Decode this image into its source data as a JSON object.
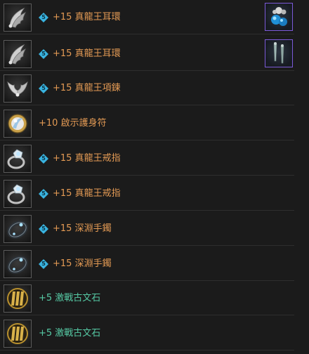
{
  "colors": {
    "orange_text": "#e39a54",
    "green_text": "#56c9a4",
    "badge_blue": "#39b3e0",
    "extra_border": "#7c5ad8",
    "background": "#1b1b1b"
  },
  "items": [
    {
      "icon": "wing-earring-icon",
      "badge": "5",
      "name": "+15 真龍王耳環",
      "color": "#e39a54",
      "extra_icon": "blue-orb-earring-icon"
    },
    {
      "icon": "wing-earring-icon",
      "badge": "5",
      "name": "+15 真龍王耳環",
      "color": "#e39a54",
      "extra_icon": "dagger-earring-icon"
    },
    {
      "icon": "wing-necklace-icon",
      "badge": "5",
      "name": "+15 真龍王項鍊",
      "color": "#e39a54"
    },
    {
      "icon": "amulet-icon",
      "badge": "",
      "name": "+10 啟示護身符",
      "color": "#e39a54"
    },
    {
      "icon": "ring-icon",
      "badge": "5",
      "name": "+15 真龍王戒指",
      "color": "#e39a54"
    },
    {
      "icon": "ring-icon",
      "badge": "5",
      "name": "+15 真龍王戒指",
      "color": "#e39a54"
    },
    {
      "icon": "bracelet-icon",
      "badge": "5",
      "name": "+15 深淵手鐲",
      "color": "#e39a54"
    },
    {
      "icon": "bracelet-icon",
      "badge": "5",
      "name": "+15 深淵手鐲",
      "color": "#e39a54"
    },
    {
      "icon": "rune-stone-icon",
      "badge": "",
      "name": "+5 激戰古文石",
      "color": "#56c9a4"
    },
    {
      "icon": "rune-stone-icon",
      "badge": "",
      "name": "+5 激戰古文石",
      "color": "#56c9a4"
    }
  ]
}
